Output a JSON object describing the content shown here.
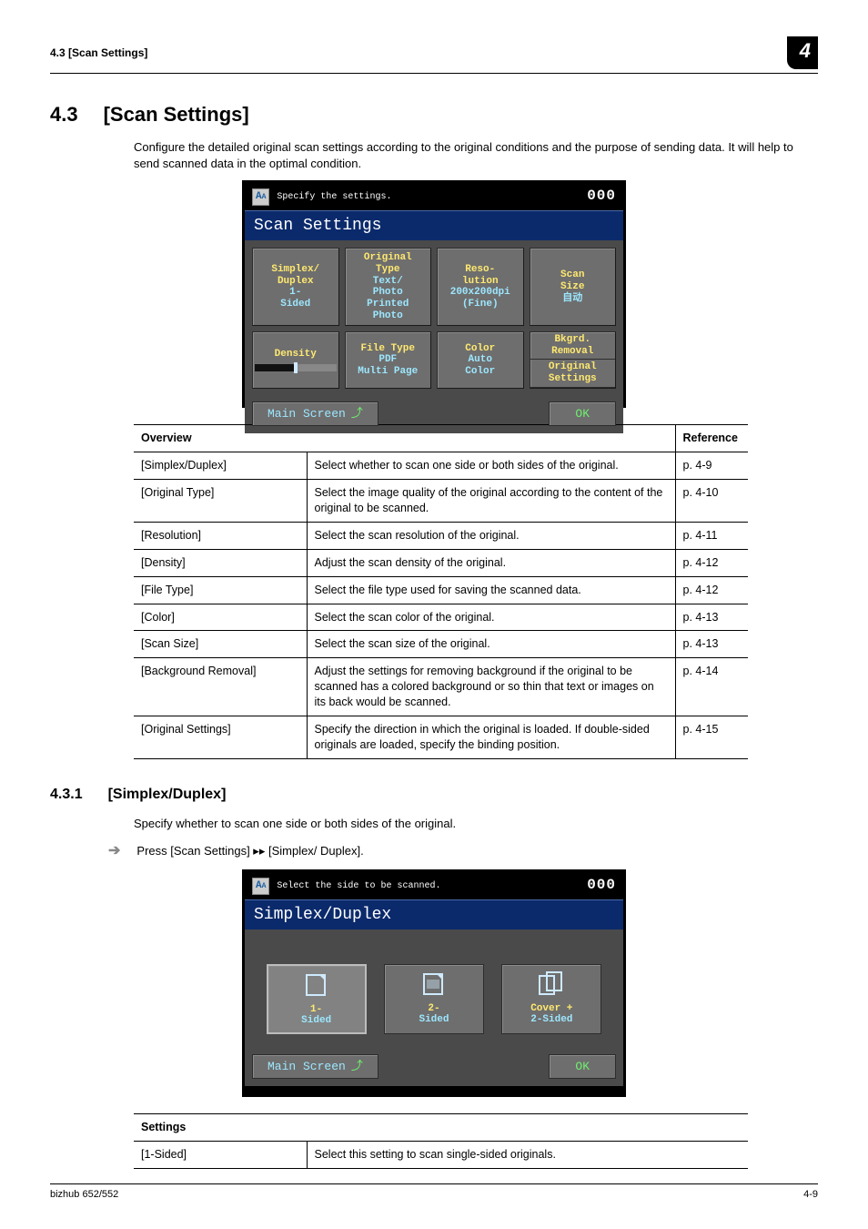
{
  "header": {
    "left": "4.3    [Scan Settings]",
    "chapter": "4"
  },
  "section": {
    "num": "4.3",
    "title": "[Scan Settings]",
    "intro": "Configure the detailed original scan settings according to the original conditions and the purpose of sending data. It will help to send scanned data in the optimal condition."
  },
  "screen1": {
    "instruction": "Specify the settings.",
    "counter": "000",
    "title": "Scan Settings",
    "tiles": [
      {
        "h": "Simplex/\nDuplex",
        "v": "1-\nSided"
      },
      {
        "h": "Original\nType",
        "v": "Text/\nPhoto\nPrinted\nPhoto"
      },
      {
        "h": "Reso-\nlution",
        "v": "200x200dpi\n(Fine)"
      },
      {
        "h": "Scan\nSize",
        "v": "自动"
      }
    ],
    "tiles2": [
      {
        "h": "Density",
        "bar": true
      },
      {
        "h": "File Type",
        "v": "PDF\nMulti Page"
      },
      {
        "h": "Color",
        "v": "Auto\nColor"
      },
      {
        "h": "Bkgrd.\nRemoval",
        "v": "Original\nSettings",
        "split": true
      }
    ],
    "main": "Main Screen",
    "ok": "OK"
  },
  "overview_table": {
    "headers": [
      "Overview",
      "",
      "Reference"
    ],
    "rows": [
      {
        "name": "[Simplex/Duplex]",
        "desc": "Select whether to scan one side or both sides of the original.",
        "ref": "p. 4-9"
      },
      {
        "name": "[Original Type]",
        "desc": "Select the image quality of the original according to the content of the original to be scanned.",
        "ref": "p. 4-10"
      },
      {
        "name": "[Resolution]",
        "desc": "Select the scan resolution of the original.",
        "ref": "p. 4-11"
      },
      {
        "name": "[Density]",
        "desc": "Adjust the scan density of the original.",
        "ref": "p. 4-12"
      },
      {
        "name": "[File Type]",
        "desc": "Select the file type used for saving the scanned data.",
        "ref": "p. 4-12"
      },
      {
        "name": "[Color]",
        "desc": "Select the scan color of the original.",
        "ref": "p. 4-13"
      },
      {
        "name": "[Scan Size]",
        "desc": "Select the scan size of the original.",
        "ref": "p. 4-13"
      },
      {
        "name": "[Background Removal]",
        "desc": "Adjust the settings for removing background if the original to be scanned has a colored background or so thin that text or images on its back would be scanned.",
        "ref": "p. 4-14"
      },
      {
        "name": "[Original Settings]",
        "desc": "Specify the direction in which the original is loaded. If double-sided originals are loaded, specify the binding position.",
        "ref": "p. 4-15"
      }
    ]
  },
  "subsection": {
    "num": "4.3.1",
    "title": "[Simplex/Duplex]",
    "intro": "Specify whether to scan one side or both sides of the original.",
    "step": "Press [Scan Settings] ▸▸ [Simplex/ Duplex]."
  },
  "screen2": {
    "instruction": "Select the side to be scanned.",
    "counter": "000",
    "title": "Simplex/Duplex",
    "options": [
      {
        "label": "1-\nSided",
        "selected": true
      },
      {
        "label": "2-\nSided",
        "selected": false
      },
      {
        "label": "Cover +\n2-Sided",
        "selected": false
      }
    ],
    "main": "Main Screen",
    "ok": "OK"
  },
  "settings_table": {
    "header": "Settings",
    "rows": [
      {
        "name": "[1-Sided]",
        "desc": "Select this setting to scan single-sided originals."
      }
    ]
  },
  "footer": {
    "left": "bizhub 652/552",
    "right": "4-9"
  }
}
